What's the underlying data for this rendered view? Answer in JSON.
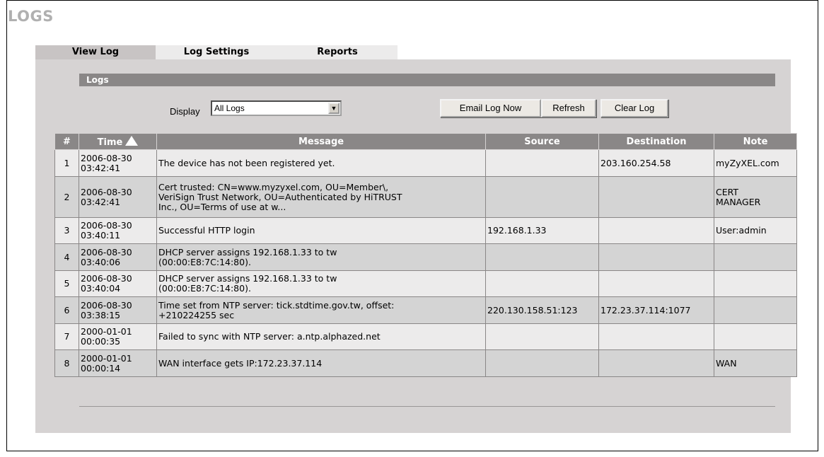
{
  "page": {
    "title": "LOGS"
  },
  "tabs": [
    {
      "label": "View Log",
      "active": true
    },
    {
      "label": "Log Settings",
      "active": false
    },
    {
      "label": "Reports",
      "active": false
    }
  ],
  "section": {
    "title": "Logs"
  },
  "controls": {
    "display_label": "Display",
    "display_value": "All Logs",
    "email_button": "Email Log Now",
    "refresh_button": "Refresh",
    "clear_button": "Clear Log"
  },
  "table": {
    "columns": [
      "#",
      "Time",
      "Message",
      "Source",
      "Destination",
      "Note"
    ],
    "sort_icon": "sort-up-arrow-icon",
    "rows": [
      {
        "num": "1",
        "time": [
          "2006-08-30",
          "03:42:41"
        ],
        "message": [
          "The device has not been registered yet."
        ],
        "source": "",
        "destination": "203.160.254.58",
        "note": [
          "myZyXEL.com"
        ]
      },
      {
        "num": "2",
        "time": [
          "2006-08-30",
          "03:42:41"
        ],
        "message": [
          "Cert trusted: CN=www.myzyxel.com, OU=Member\\,",
          "VeriSign Trust Network, OU=Authenticated by HiTRUST",
          "Inc., OU=Terms of use at w..."
        ],
        "source": "",
        "destination": "",
        "note": [
          "CERT",
          "MANAGER"
        ]
      },
      {
        "num": "3",
        "time": [
          "2006-08-30",
          "03:40:11"
        ],
        "message": [
          "Successful HTTP login"
        ],
        "source": "192.168.1.33",
        "destination": "",
        "note": [
          "User:admin"
        ]
      },
      {
        "num": "4",
        "time": [
          "2006-08-30",
          "03:40:06"
        ],
        "message": [
          "DHCP server assigns 192.168.1.33 to tw",
          "(00:00:E8:7C:14:80)."
        ],
        "source": "",
        "destination": "",
        "note": [
          ""
        ]
      },
      {
        "num": "5",
        "time": [
          "2006-08-30",
          "03:40:04"
        ],
        "message": [
          "DHCP server assigns 192.168.1.33 to tw",
          "(00:00:E8:7C:14:80)."
        ],
        "source": "",
        "destination": "",
        "note": [
          ""
        ]
      },
      {
        "num": "6",
        "time": [
          "2006-08-30",
          "03:38:15"
        ],
        "message": [
          "Time set from NTP server: tick.stdtime.gov.tw, offset:",
          "+210224255 sec"
        ],
        "source": "220.130.158.51:123",
        "destination": "172.23.37.114:1077",
        "note": [
          ""
        ]
      },
      {
        "num": "7",
        "time": [
          "2000-01-01",
          "00:00:35"
        ],
        "message": [
          "Failed to sync with NTP server: a.ntp.alphazed.net"
        ],
        "source": "",
        "destination": "",
        "note": [
          ""
        ]
      },
      {
        "num": "8",
        "time": [
          "2000-01-01",
          "00:00:14"
        ],
        "message": [
          "WAN interface gets IP:172.23.37.114"
        ],
        "source": "",
        "destination": "",
        "note": [
          "WAN"
        ]
      }
    ]
  }
}
